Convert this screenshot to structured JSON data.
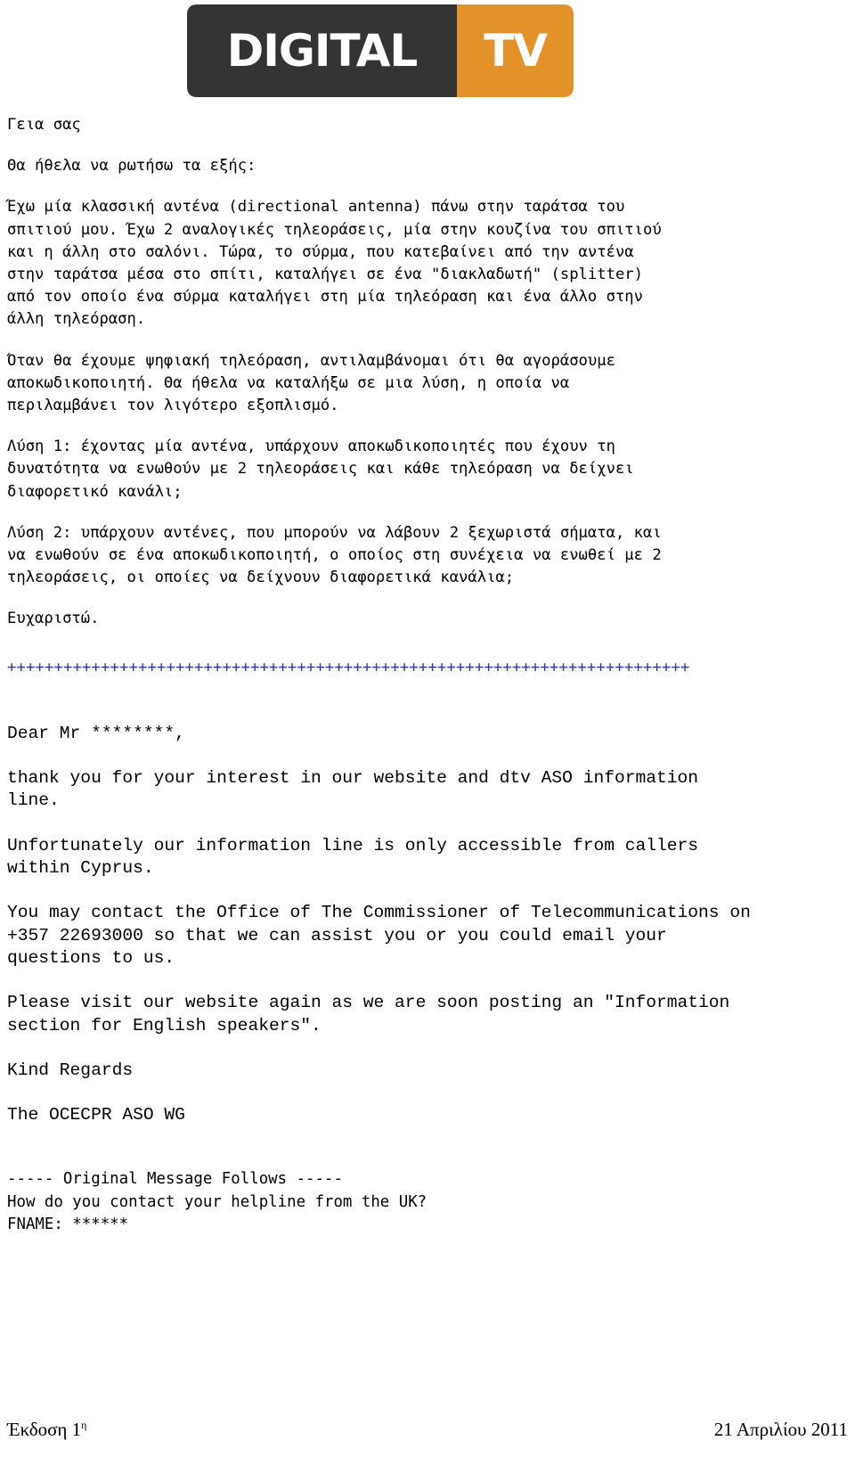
{
  "logo": {
    "dark_word": "DIGITAL",
    "orange_word": "TV",
    "dark_color": "#333333",
    "orange_color": "#e3922a",
    "text_color": "#ffffff"
  },
  "letter_gr": {
    "greeting": "Γεια σας",
    "intro": "Θα ήθελα να ρωτήσω τα εξής:",
    "para1": "Έχω μία κλασσική αντένα (directional antenna) πάνω στην ταράτσα του\nσπιτιού μου. Έχω 2 αναλογικές τηλεοράσεις, μία στην κουζίνα του σπιτιού\nκαι η άλλη στο σαλόνι. Τώρα, το σύρμα, που κατεβαίνει από την αντένα\nστην ταράτσα μέσα στο σπίτι, καταλήγει σε ένα \"διακλαδωτή\" (splitter)\nαπό τον οποίο ένα σύρμα καταλήγει στη μία τηλεόραση και ένα άλλο στην\nάλλη τηλεόραση.",
    "para2": "Όταν θα έχουμε ψηφιακή τηλεόραση, αντιλαμβάνομαι ότι θα αγοράσουμε\nαποκωδικοποιητή. Θα ήθελα να καταλήξω σε μια λύση, η οποία να\nπεριλαμβάνει τον λιγότερο εξοπλισμό.",
    "solution1": "Λύση 1: έχοντας μία αντένα, υπάρχουν αποκωδικοποιητές που έχουν τη\nδυνατότητα να ενωθούν με 2 τηλεοράσεις και κάθε τηλεόραση να δείχνει\nδιαφορετικό κανάλι;",
    "solution2": "Λύση 2: υπάρχουν αντένες, που μπορούν να λάβουν 2 ξεχωριστά σήματα, και\nνα ενωθούν σε ένα αποκωδικοποιητή, ο οποίος στη συνέχεια να ενωθεί με 2\nτηλεοράσεις, οι οποίες να δείχνουν διαφορετικά κανάλια;",
    "thanks": "Ευχαριστώ."
  },
  "separator": {
    "text": "+++++++++++++++++++++++++++++++++++++++++++++++++++++++++++++++++++++++++",
    "color": "#2a3b8f"
  },
  "letter_en": {
    "salutation": "Dear Mr ********,",
    "para1": "thank you for your interest in our website and dtv ASO information\nline.",
    "para2": "Unfortunately our information line is only accessible from callers\nwithin Cyprus.",
    "para3": "You may contact the Office of The Commissioner of Telecommunications on\n+357 22693000 so that we can assist you or you could email your\nquestions to us.",
    "para4": "Please visit our website again as we are soon posting an \"Information\nsection for English speakers\".",
    "signoff": "Kind Regards",
    "sender": "The OCECPR ASO WG"
  },
  "original_message": {
    "header": "----- Original Message Follows -----",
    "line1": "How do you contact your helpline from the UK?",
    "line2": "FNAME: ******"
  },
  "footer": {
    "edition_label": "Έκδοση 1",
    "edition_sup": "η",
    "date": "21 Απριλίου 2011"
  }
}
